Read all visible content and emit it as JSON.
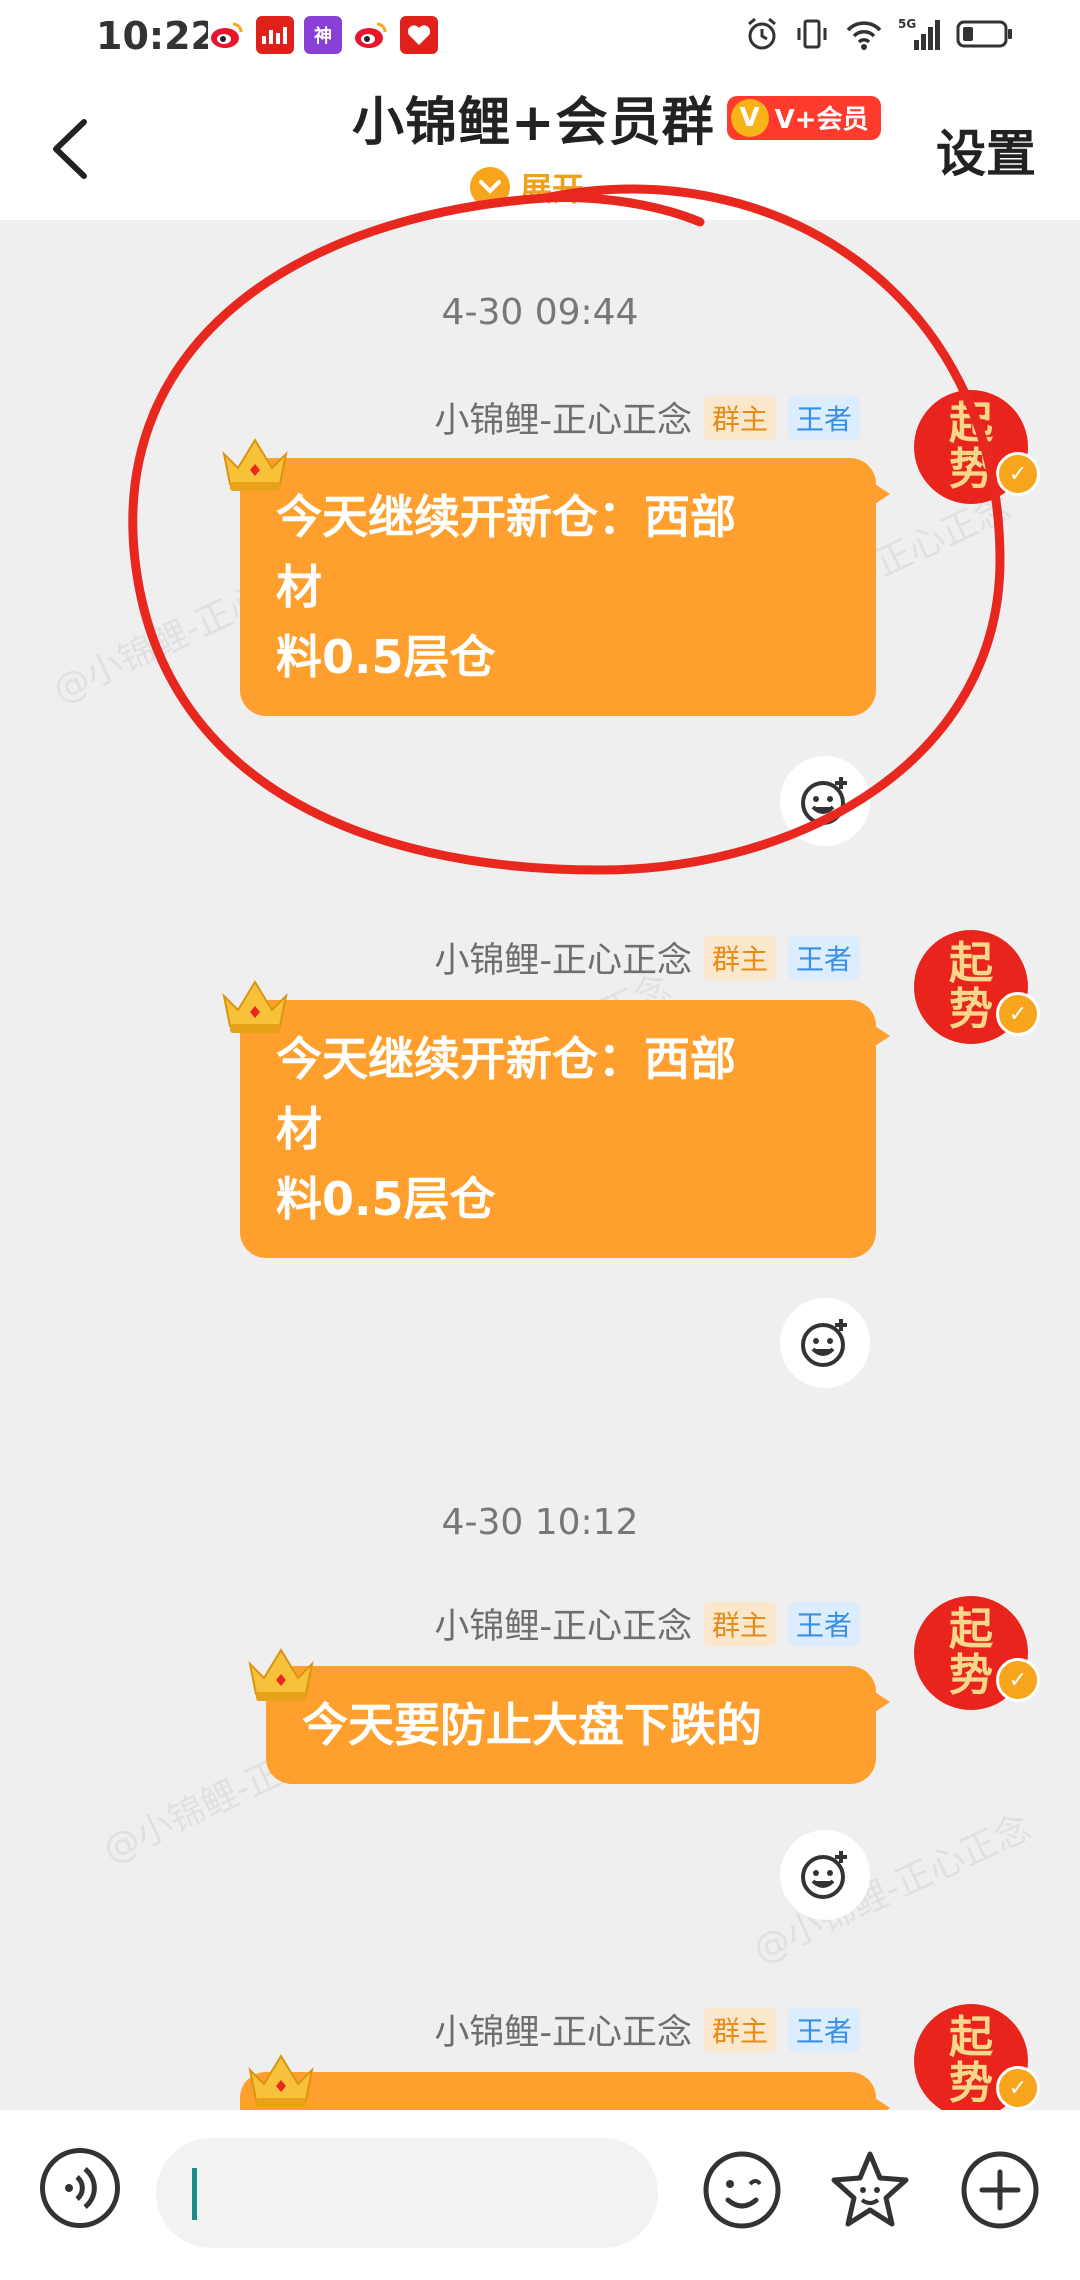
{
  "status_bar": {
    "time": "10:22",
    "app_icons": [
      "weibo-icon",
      "news-icon",
      "shenpai-icon",
      "weibo-icon",
      "heart-app-icon"
    ],
    "network": "5G"
  },
  "header": {
    "title": "小锦鲤+会员群",
    "vip_badge": "V+会员",
    "vip_letter": "V",
    "expand_label": "展开",
    "settings_label": "设置"
  },
  "messages": [
    {
      "timestamp": "4-30 09:44",
      "sender": "小锦鲤-正心正念",
      "tag_owner": "群主",
      "tag_level": "王者",
      "lines": [
        "今天继续开新仓：西部",
        "材",
        "料0.5层仓"
      ],
      "avatar_text": [
        "起",
        "势"
      ]
    },
    {
      "timestamp": "",
      "sender": "小锦鲤-正心正念",
      "tag_owner": "群主",
      "tag_level": "王者",
      "lines": [
        "今天继续开新仓：西部",
        "材",
        "料0.5层仓"
      ],
      "avatar_text": [
        "起",
        "势"
      ]
    },
    {
      "timestamp": "4-30 10:12",
      "sender": "小锦鲤-正心正念",
      "tag_owner": "群主",
      "tag_level": "王者",
      "lines": [
        "今天要防止大盘下跌的"
      ],
      "avatar_text": [
        "起",
        "势"
      ]
    },
    {
      "timestamp": "",
      "sender": "小锦鲤-正心正念",
      "tag_owner": "群主",
      "tag_level": "王者",
      "lines": [],
      "avatar_text": [
        "起",
        "势"
      ]
    }
  ],
  "watermark_text": "@小锦鲤-正心正念",
  "input_bar": {
    "value": "",
    "icons": [
      "voice-icon",
      "emoji-icon",
      "sticker-icon",
      "plus-icon"
    ]
  },
  "colors": {
    "bubble": "#ff9f2d",
    "accent": "#f7a51c",
    "annotation": "#e8281e",
    "avatar": "#e9241d"
  }
}
